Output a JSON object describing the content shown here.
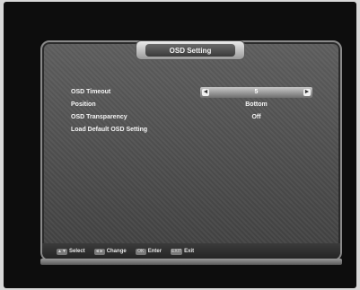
{
  "window": {
    "title": "OSD Setting"
  },
  "menu": {
    "items": [
      {
        "label": "OSD Timeout",
        "value": "5",
        "highlighted": true
      },
      {
        "label": "Position",
        "value": "Bottom",
        "highlighted": false
      },
      {
        "label": "OSD Transparency",
        "value": "Off",
        "highlighted": false
      },
      {
        "label": "Load Default OSD Setting",
        "value": "",
        "highlighted": false
      }
    ]
  },
  "hints": [
    {
      "key": "▲▼",
      "label": "Select"
    },
    {
      "key": "◄►",
      "label": "Change"
    },
    {
      "key": "OK",
      "label": "Enter"
    },
    {
      "key": "EXIT",
      "label": "Exit"
    }
  ]
}
